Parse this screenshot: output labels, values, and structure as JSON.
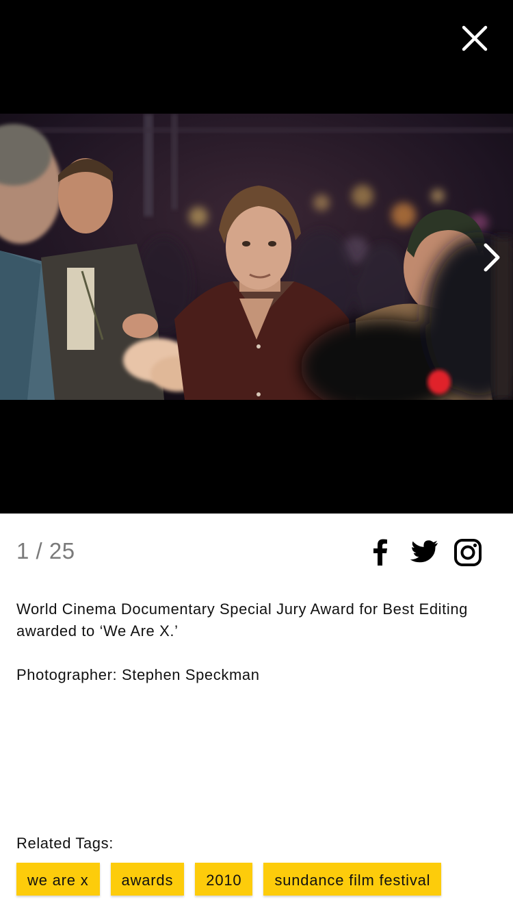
{
  "viewer": {
    "close_icon": "close-icon",
    "next_icon": "chevron-right-icon"
  },
  "info": {
    "counter": "1 / 25",
    "social": [
      {
        "name": "facebook-icon"
      },
      {
        "name": "twitter-icon"
      },
      {
        "name": "instagram-icon"
      }
    ],
    "caption": "World Cinema Documentary Special Jury Award for Best Editing awarded to ‘We Are X.’",
    "credit_label": "Photographer:",
    "credit_name": "Stephen Speckman",
    "tags_label": "Related Tags:",
    "tags": [
      "we are x",
      "awards",
      "2010",
      "sundance film festival"
    ]
  },
  "colors": {
    "tag_background": "#fdcc0b",
    "viewer_background": "#000000",
    "counter_text": "#7a7a7a"
  }
}
